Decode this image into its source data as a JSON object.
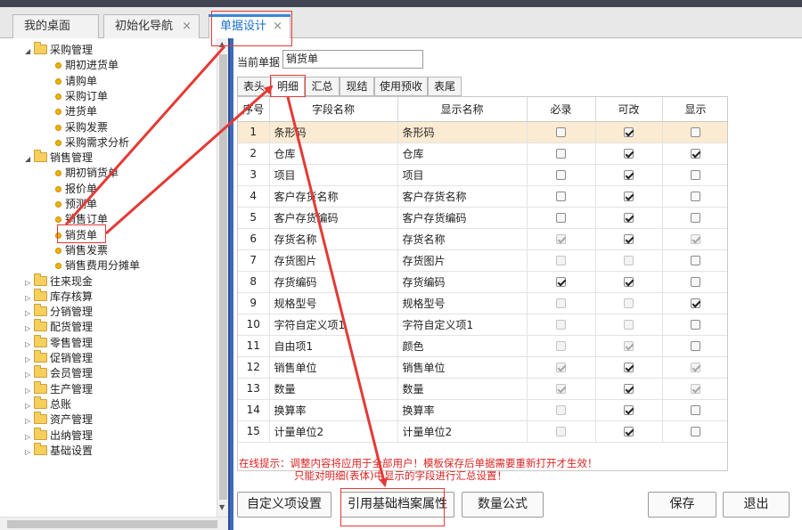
{
  "tabs": [
    {
      "label": "我的桌面",
      "close": ""
    },
    {
      "label": "初始化导航",
      "close": "×"
    },
    {
      "label": "单据设计",
      "close": "×"
    }
  ],
  "tree": [
    {
      "label": "采购管理",
      "kind": "folder",
      "open": true
    },
    {
      "label": "期初进货单",
      "kind": "leaf"
    },
    {
      "label": "请购单",
      "kind": "leaf"
    },
    {
      "label": "采购订单",
      "kind": "leaf"
    },
    {
      "label": "进货单",
      "kind": "leaf"
    },
    {
      "label": "采购发票",
      "kind": "leaf"
    },
    {
      "label": "采购需求分析",
      "kind": "leaf"
    },
    {
      "label": "销售管理",
      "kind": "folder",
      "open": true
    },
    {
      "label": "期初销货单",
      "kind": "leaf"
    },
    {
      "label": "报价单",
      "kind": "leaf"
    },
    {
      "label": "预测单",
      "kind": "leaf"
    },
    {
      "label": "销售订单",
      "kind": "leaf"
    },
    {
      "label": "销货单",
      "kind": "leaf",
      "selected": true
    },
    {
      "label": "销售发票",
      "kind": "leaf"
    },
    {
      "label": "销售费用分摊单",
      "kind": "leaf"
    },
    {
      "label": "往来现金",
      "kind": "folder"
    },
    {
      "label": "库存核算",
      "kind": "folder"
    },
    {
      "label": "分销管理",
      "kind": "folder"
    },
    {
      "label": "配货管理",
      "kind": "folder"
    },
    {
      "label": "零售管理",
      "kind": "folder"
    },
    {
      "label": "促销管理",
      "kind": "folder"
    },
    {
      "label": "会员管理",
      "kind": "folder"
    },
    {
      "label": "生产管理",
      "kind": "folder"
    },
    {
      "label": "总账",
      "kind": "folder"
    },
    {
      "label": "资产管理",
      "kind": "folder"
    },
    {
      "label": "出纳管理",
      "kind": "folder"
    },
    {
      "label": "基础设置",
      "kind": "folder"
    }
  ],
  "current_doc": {
    "label": "当前单据",
    "value": "销货单"
  },
  "sub_tabs": [
    "表头",
    "明细",
    "汇总",
    "现结",
    "使用预收",
    "表尾"
  ],
  "active_sub_tab": "明细",
  "grid": {
    "headers": [
      "序号",
      "字段名称",
      "显示名称",
      "必录",
      "可改",
      "显示"
    ],
    "selected_row": 1,
    "rows": [
      {
        "no": "1",
        "field": "条形码",
        "display": "条形码",
        "required": false,
        "editable": true,
        "visible": false
      },
      {
        "no": "2",
        "field": "仓库",
        "display": "仓库",
        "required": false,
        "editable": true,
        "visible": true
      },
      {
        "no": "3",
        "field": "项目",
        "display": "项目",
        "required": false,
        "editable": true,
        "visible": false
      },
      {
        "no": "4",
        "field": "客户存货名称",
        "display": "客户存货名称",
        "required": false,
        "editable": true,
        "visible": false
      },
      {
        "no": "5",
        "field": "客户存货编码",
        "display": "客户存货编码",
        "required": false,
        "editable": true,
        "visible": false
      },
      {
        "no": "6",
        "field": "存货名称",
        "display": "存货名称",
        "required": true,
        "editable": true,
        "visible": true,
        "dis_req": true,
        "dis_vis": true
      },
      {
        "no": "7",
        "field": "存货图片",
        "display": "存货图片",
        "required": false,
        "editable": false,
        "visible": false,
        "dis_req": true,
        "dis_edit": true
      },
      {
        "no": "8",
        "field": "存货编码",
        "display": "存货编码",
        "required": true,
        "editable": true,
        "visible": false
      },
      {
        "no": "9",
        "field": "规格型号",
        "display": "规格型号",
        "required": false,
        "editable": false,
        "visible": true,
        "dis_req": true,
        "dis_edit": true
      },
      {
        "no": "10",
        "field": "字符自定义项1",
        "display": "字符自定义项1",
        "required": false,
        "editable": false,
        "visible": false,
        "dis_req": true,
        "dis_edit": true
      },
      {
        "no": "11",
        "field": "自由项1",
        "display": "颜色",
        "required": false,
        "editable": true,
        "visible": false,
        "dis_req": true,
        "dis_edit": true
      },
      {
        "no": "12",
        "field": "销售单位",
        "display": "销售单位",
        "required": true,
        "editable": true,
        "visible": true,
        "dis_req": true,
        "dis_vis": true
      },
      {
        "no": "13",
        "field": "数量",
        "display": "数量",
        "required": true,
        "editable": true,
        "visible": true,
        "dis_req": true,
        "dis_vis": true
      },
      {
        "no": "14",
        "field": "换算率",
        "display": "换算率",
        "required": false,
        "editable": true,
        "visible": false,
        "dis_req": true
      },
      {
        "no": "15",
        "field": "计量单位2",
        "display": "计量单位2",
        "required": false,
        "editable": true,
        "visible": false,
        "dis_req": true
      }
    ]
  },
  "hint": {
    "line1": "在线提示：调整内容将应用于全部用户！模板保存后单据需要重新打开才生效！",
    "line2": "只能对明细(表体)中显示的字段进行汇总设置！"
  },
  "buttons": {
    "custom_items": "自定义项设置",
    "ref_archive": "引用基础档案属性",
    "qty_formula": "数量公式",
    "save": "保存",
    "exit": "退出"
  },
  "colors": {
    "annotation": "#e53935",
    "selected_row": "#fbebd2",
    "active_tab_text": "#1a6fc8"
  }
}
